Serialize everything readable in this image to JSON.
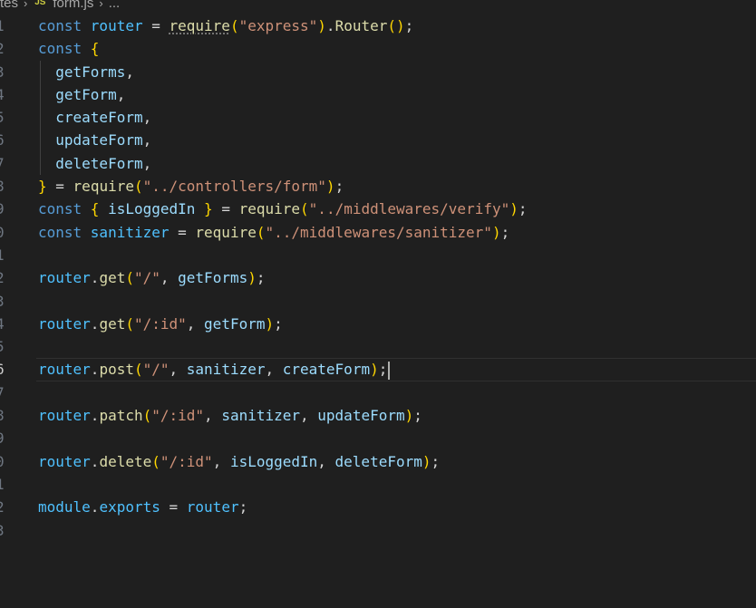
{
  "breadcrumb": {
    "folder": "tes",
    "file_badge": "JS",
    "file": "form.js",
    "more": "..."
  },
  "editor": {
    "line_numbers": [
      "1",
      "2",
      "3",
      "4",
      "5",
      "6",
      "7",
      "8",
      "9",
      "0",
      "1",
      "2",
      "3",
      "4",
      "5",
      "6",
      "7",
      "8",
      "9",
      "0",
      "1",
      "2",
      "3"
    ],
    "lines": [
      [
        [
          "kw",
          "const "
        ],
        [
          "var",
          "router"
        ],
        [
          "plain",
          " = "
        ],
        [
          "fn",
          "require"
        ],
        [
          "br1",
          "("
        ],
        [
          "str",
          "\"express\""
        ],
        [
          "br1",
          ")"
        ],
        [
          "plain",
          "."
        ],
        [
          "fn",
          "Router"
        ],
        [
          "br1",
          "()"
        ],
        [
          "plain",
          ";"
        ]
      ],
      [
        [
          "kw",
          "const "
        ],
        [
          "br1",
          "{"
        ]
      ],
      [
        [
          "plain",
          "  "
        ],
        [
          "id",
          "getForms"
        ],
        [
          "plain",
          ","
        ]
      ],
      [
        [
          "plain",
          "  "
        ],
        [
          "id",
          "getForm"
        ],
        [
          "plain",
          ","
        ]
      ],
      [
        [
          "plain",
          "  "
        ],
        [
          "id",
          "createForm"
        ],
        [
          "plain",
          ","
        ]
      ],
      [
        [
          "plain",
          "  "
        ],
        [
          "id",
          "updateForm"
        ],
        [
          "plain",
          ","
        ]
      ],
      [
        [
          "plain",
          "  "
        ],
        [
          "id",
          "deleteForm"
        ],
        [
          "plain",
          ","
        ]
      ],
      [
        [
          "br1",
          "}"
        ],
        [
          "plain",
          " = "
        ],
        [
          "fn",
          "require"
        ],
        [
          "br1",
          "("
        ],
        [
          "str",
          "\"../controllers/form\""
        ],
        [
          "br1",
          ")"
        ],
        [
          "plain",
          ";"
        ]
      ],
      [
        [
          "kw",
          "const "
        ],
        [
          "br1",
          "{"
        ],
        [
          "plain",
          " "
        ],
        [
          "id",
          "isLoggedIn"
        ],
        [
          "plain",
          " "
        ],
        [
          "br1",
          "}"
        ],
        [
          "plain",
          " = "
        ],
        [
          "fn",
          "require"
        ],
        [
          "br1",
          "("
        ],
        [
          "str",
          "\"../middlewares/verify\""
        ],
        [
          "br1",
          ")"
        ],
        [
          "plain",
          ";"
        ]
      ],
      [
        [
          "kw",
          "const "
        ],
        [
          "var",
          "sanitizer"
        ],
        [
          "plain",
          " = "
        ],
        [
          "fn",
          "require"
        ],
        [
          "br1",
          "("
        ],
        [
          "str",
          "\"../middlewares/sanitizer\""
        ],
        [
          "br1",
          ")"
        ],
        [
          "plain",
          ";"
        ]
      ],
      [],
      [
        [
          "var",
          "router"
        ],
        [
          "plain",
          "."
        ],
        [
          "fn",
          "get"
        ],
        [
          "br1",
          "("
        ],
        [
          "str",
          "\"/\""
        ],
        [
          "plain",
          ", "
        ],
        [
          "id",
          "getForms"
        ],
        [
          "br1",
          ")"
        ],
        [
          "plain",
          ";"
        ]
      ],
      [],
      [
        [
          "var",
          "router"
        ],
        [
          "plain",
          "."
        ],
        [
          "fn",
          "get"
        ],
        [
          "br1",
          "("
        ],
        [
          "str",
          "\"/:id\""
        ],
        [
          "plain",
          ", "
        ],
        [
          "id",
          "getForm"
        ],
        [
          "br1",
          ")"
        ],
        [
          "plain",
          ";"
        ]
      ],
      [],
      [
        [
          "var",
          "router"
        ],
        [
          "plain",
          "."
        ],
        [
          "fn",
          "post"
        ],
        [
          "br1",
          "("
        ],
        [
          "str",
          "\"/\""
        ],
        [
          "plain",
          ", "
        ],
        [
          "id",
          "sanitizer"
        ],
        [
          "plain",
          ", "
        ],
        [
          "id",
          "createForm"
        ],
        [
          "br1",
          ")"
        ],
        [
          "plain",
          ";"
        ]
      ],
      [],
      [
        [
          "var",
          "router"
        ],
        [
          "plain",
          "."
        ],
        [
          "fn",
          "patch"
        ],
        [
          "br1",
          "("
        ],
        [
          "str",
          "\"/:id\""
        ],
        [
          "plain",
          ", "
        ],
        [
          "id",
          "sanitizer"
        ],
        [
          "plain",
          ", "
        ],
        [
          "id",
          "updateForm"
        ],
        [
          "br1",
          ")"
        ],
        [
          "plain",
          ";"
        ]
      ],
      [],
      [
        [
          "var",
          "router"
        ],
        [
          "plain",
          "."
        ],
        [
          "fn",
          "delete"
        ],
        [
          "br1",
          "("
        ],
        [
          "str",
          "\"/:id\""
        ],
        [
          "plain",
          ", "
        ],
        [
          "id",
          "isLoggedIn"
        ],
        [
          "plain",
          ", "
        ],
        [
          "id",
          "deleteForm"
        ],
        [
          "br1",
          ")"
        ],
        [
          "plain",
          ";"
        ]
      ],
      [],
      [
        [
          "var",
          "module"
        ],
        [
          "plain",
          "."
        ],
        [
          "var",
          "exports"
        ],
        [
          "plain",
          " = "
        ],
        [
          "var",
          "router"
        ],
        [
          "plain",
          ";"
        ]
      ],
      []
    ],
    "current_line_index": 15
  }
}
